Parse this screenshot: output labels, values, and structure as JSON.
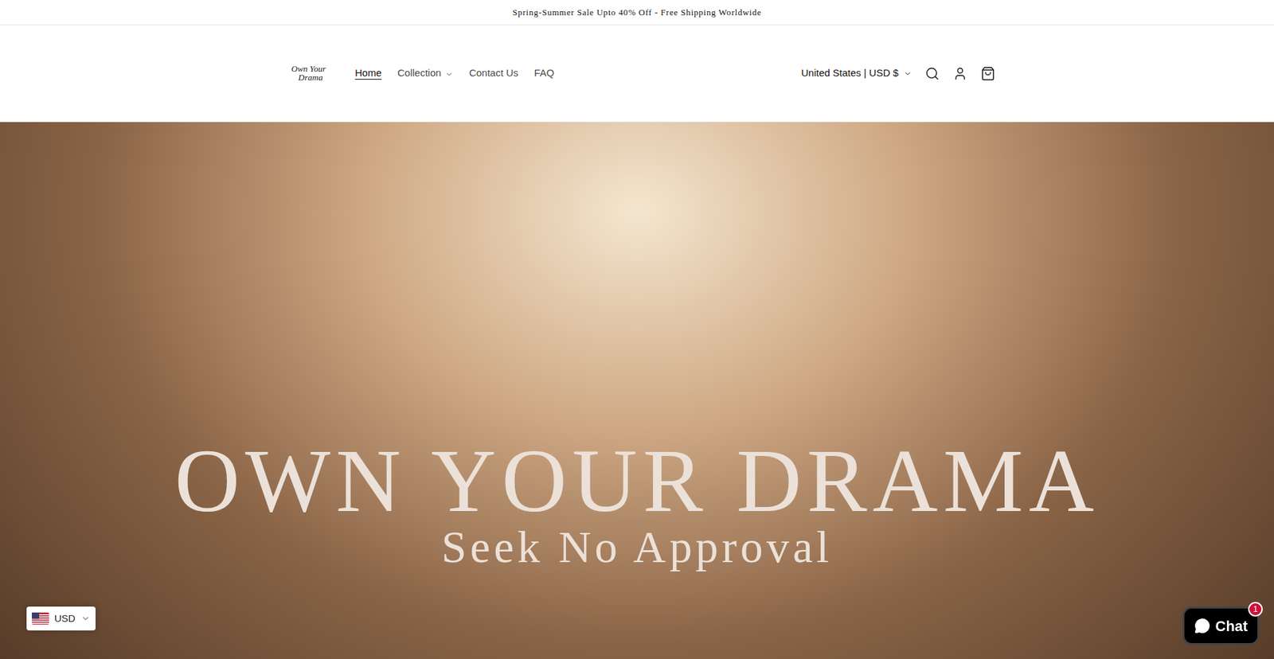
{
  "announcement": "Spring-Summer Sale Upto 40% Off - Free Shipping Worldwide",
  "logo": {
    "line1": "Own Your",
    "line2": "Drama"
  },
  "nav": [
    {
      "label": "Home",
      "selected": true,
      "dropdown": false
    },
    {
      "label": "Collection",
      "selected": false,
      "dropdown": true
    },
    {
      "label": "Contact Us",
      "selected": false,
      "dropdown": false
    },
    {
      "label": "FAQ",
      "selected": false,
      "dropdown": false
    }
  ],
  "localization": "United States | USD $",
  "hero": {
    "title": "OWN YOUR DRAMA",
    "subtitle": "Seek No Approval"
  },
  "currency_widget": {
    "label": "USD"
  },
  "chat": {
    "label": "Chat",
    "badge": "1"
  }
}
